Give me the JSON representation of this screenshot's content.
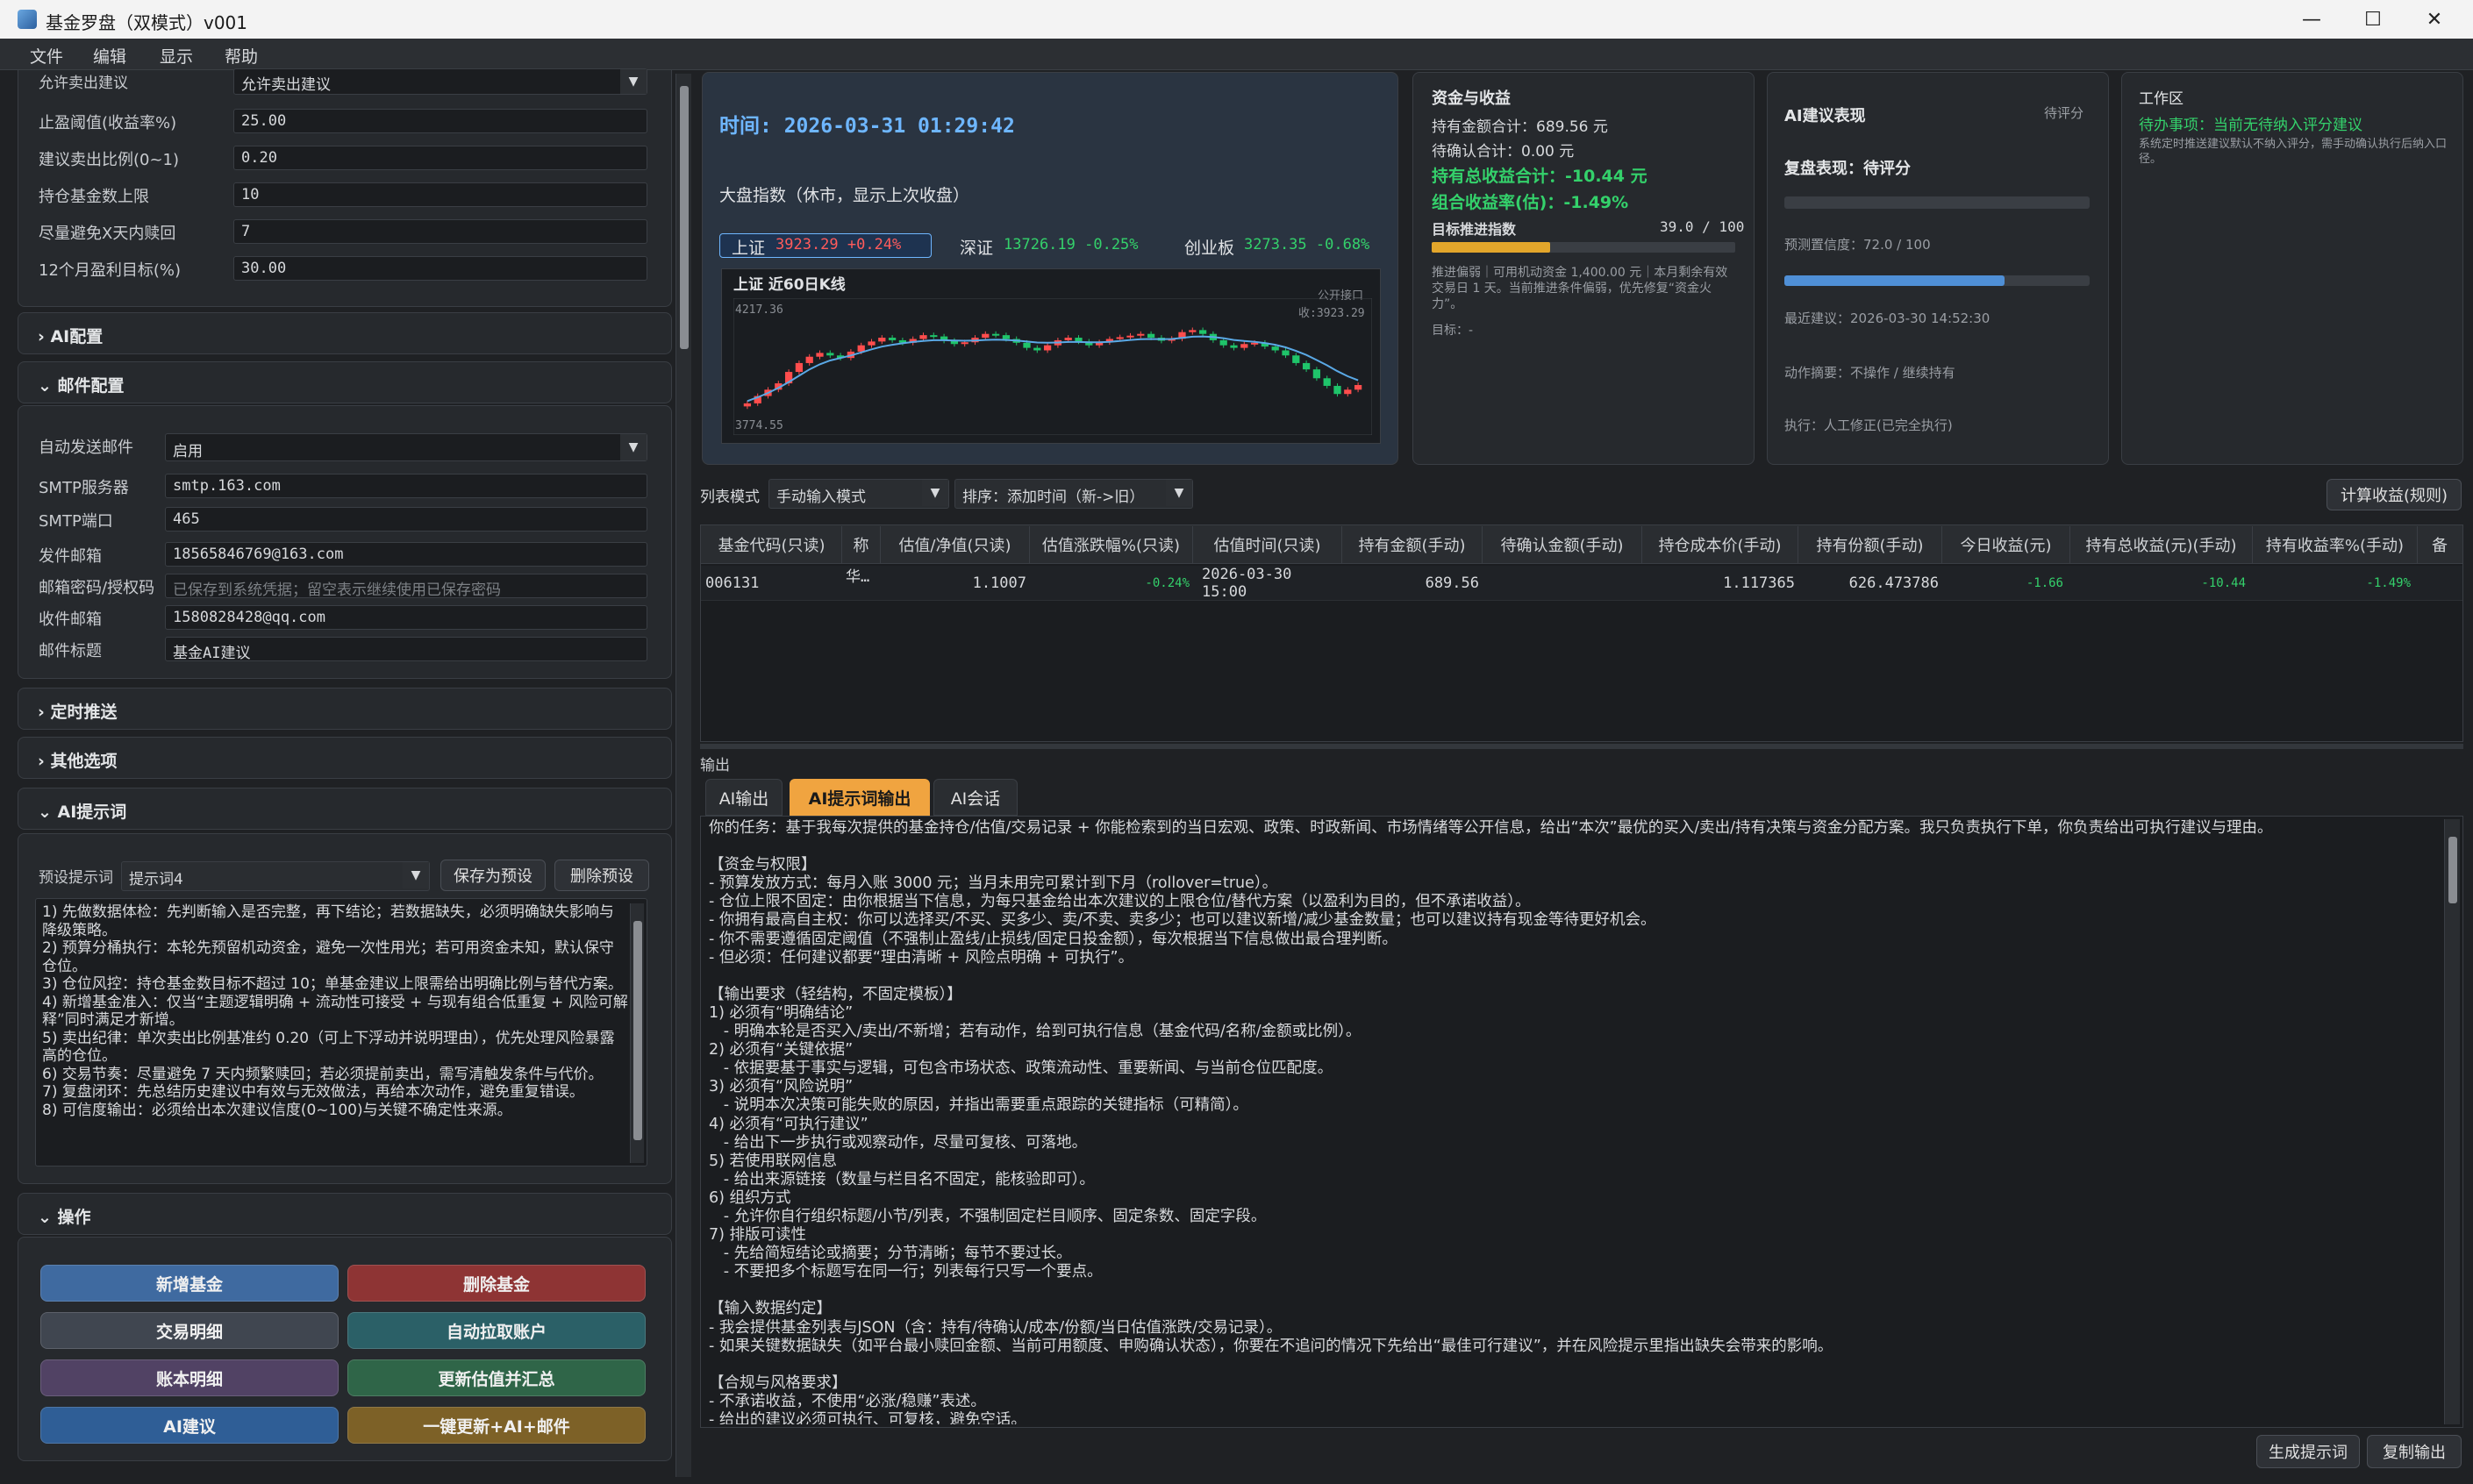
{
  "window": {
    "title": "基金罗盘（双模式）v001",
    "minimize": "—",
    "maximize": "☐",
    "close": "✕"
  },
  "menu": [
    "文件",
    "编辑",
    "显示",
    "帮助"
  ],
  "left": {
    "sell_row": {
      "label": "允许卖出建议",
      "value": "允许卖出建议"
    },
    "params": [
      {
        "label": "止盈阈值(收益率%)",
        "value": "25.00"
      },
      {
        "label": "建议卖出比例(0~1)",
        "value": "0.20"
      },
      {
        "label": "持仓基金数上限",
        "value": "10"
      },
      {
        "label": "尽量避免X天内赎回",
        "value": "7"
      },
      {
        "label": "12个月盈利目标(%)",
        "value": "30.00"
      }
    ],
    "sections": {
      "ai_config": "› AI配置",
      "mail_config": "⌄ 邮件配置",
      "schedule": "› 定时推送",
      "other": "› 其他选项",
      "ai_prompt": "⌄ AI提示词",
      "ops": "⌄ 操作"
    },
    "mail": {
      "auto_send_label": "自动发送邮件",
      "auto_send_value": "启用",
      "smtp_label": "SMTP服务器",
      "smtp_value": "smtp.163.com",
      "port_label": "SMTP端口",
      "port_value": "465",
      "from_label": "发件邮箱",
      "from_value": "18565846769@163.com",
      "pwd_label": "邮箱密码/授权码",
      "pwd_placeholder": "已保存到系统凭据；留空表示继续使用已保存密码",
      "to_label": "收件邮箱",
      "to_value": "1580828428@qq.com",
      "subject_label": "邮件标题",
      "subject_value": "基金AI建议"
    },
    "prompt": {
      "preset_label": "预设提示词",
      "preset_value": "提示词4",
      "save_btn": "保存为预设",
      "delete_btn": "删除预设",
      "lines": [
        "1) 先做数据体检：先判断输入是否完整，再下结论；若数据缺失，必须明确缺失影响与降级策略。",
        "2) 预算分桶执行：本轮先预留机动资金，避免一次性用光；若可用资金未知，默认保守仓位。",
        "3) 仓位风控：持仓基金数目标不超过 10；单基金建议上限需给出明确比例与替代方案。",
        "4) 新增基金准入：仅当“主题逻辑明确 + 流动性可接受 + 与现有组合低重复 + 风险可解释”同时满足才新增。",
        "5) 卖出纪律：单次卖出比例基准约 0.20（可上下浮动并说明理由），优先处理风险暴露高的仓位。",
        "6) 交易节奏：尽量避免 7 天内频繁赎回；若必须提前卖出，需写清触发条件与代价。",
        "7) 复盘闭环：先总结历史建议中有效与无效做法，再给本次动作，避免重复错误。",
        "8) 可信度输出：必须给出本次建议信度(0~100)与关键不确定性来源。"
      ]
    },
    "ops": {
      "add_fund": "新增基金",
      "delete_fund": "删除基金",
      "trade_detail": "交易明细",
      "auto_pull": "自动拉取账户",
      "account_detail": "账本明细",
      "update_valuation": "更新估值并汇总",
      "ai_suggest": "AI建议",
      "one_click": "一键更新+AI+邮件"
    }
  },
  "market": {
    "time": "时间: 2026-03-31 01:29:42",
    "index_title": "大盘指数（休市，显示上次收盘）",
    "sh": {
      "name": "上证",
      "value": "3923.29 +0.24%"
    },
    "sz": {
      "name": "深证",
      "value": "13726.19 -0.25%"
    },
    "cyb": {
      "name": "创业板",
      "value": "3273.35 -0.68%"
    }
  },
  "kchart": {
    "title": "上证 近60日K线",
    "source": "公开接口",
    "high_label": "4217.36",
    "low_label": "3774.55",
    "close_label": "收:3923.29"
  },
  "chart_data": {
    "type": "candlestick",
    "title": "上证 近60日K线",
    "ylim": [
      3774.55,
      4217.36
    ],
    "close": [
      3851,
      3880,
      3905,
      3930,
      3975,
      4010,
      4035,
      4050,
      4040,
      4030,
      4055,
      4080,
      4095,
      4110,
      4100,
      4090,
      4105,
      4120,
      4115,
      4098,
      4085,
      4092,
      4110,
      4125,
      4120,
      4105,
      4090,
      4070,
      4060,
      4080,
      4100,
      4110,
      4095,
      4080,
      4092,
      4105,
      4112,
      4118,
      4125,
      4110,
      4098,
      4106,
      4132,
      4140,
      4125,
      4100,
      4080,
      4070,
      4085,
      4090,
      4075,
      4060,
      4040,
      4010,
      3985,
      3950,
      3920,
      3888,
      3905,
      3923.29
    ],
    "ma": [
      3860,
      3875,
      3892,
      3912,
      3935,
      3960,
      3985,
      4005,
      4020,
      4030,
      4040,
      4052,
      4064,
      4075,
      4082,
      4088,
      4093,
      4097,
      4100,
      4100,
      4099,
      4098,
      4099,
      4101,
      4102,
      4101,
      4099,
      4095,
      4091,
      4090,
      4091,
      4093,
      4093,
      4092,
      4092,
      4094,
      4097,
      4101,
      4104,
      4105,
      4104,
      4105,
      4109,
      4114,
      4115,
      4113,
      4108,
      4101,
      4097,
      4094,
      4089,
      4082,
      4072,
      4058,
      4042,
      4022,
      4001,
      3978,
      3958,
      3942
    ]
  },
  "capital": {
    "title": "资金与收益",
    "hold_total": "持有金额合计：689.56 元",
    "pending_total": "待确认合计：0.00 元",
    "profit_total": "持有总收益合计：-10.44 元",
    "rate": "组合收益率(估)：-1.49%",
    "goal_label": "目标推进指数",
    "goal_value": "39.0 / 100",
    "goal_progress": 0.39,
    "note": "推进偏弱｜可用机动资金 1,400.00 元｜本月剩余有效交易日 1 天。当前推进条件偏弱，优先修复“资金火力”。",
    "target": "目标：-"
  },
  "ai_perf": {
    "title": "AI建议表现",
    "pending": "待评分",
    "review": "复盘表现：待评分",
    "review_progress": 0,
    "confidence": "预测置信度：72.0 / 100",
    "confidence_progress": 0.72,
    "latest": "最近建议：2026-03-30 14:52:30",
    "action": "动作摘要：不操作 / 继续持有",
    "exec": "执行：人工修正(已完全执行)"
  },
  "workspace": {
    "title": "工作区",
    "todo": "待办事项：当前无待纳入评分建议",
    "desc": "系统定时推送建议默认不纳入评分，需手动确认执行后纳入口径。"
  },
  "list": {
    "mode_label": "列表模式",
    "mode_value": "手动输入模式",
    "sort_value": "排序：添加时间（新->旧）",
    "calc_btn": "计算收益(规则)",
    "headers": [
      "基金代码(只读)",
      "称",
      "估值/净值(只读)",
      "估值涨跌幅%(只读)",
      "估值时间(只读)",
      "持有金额(手动)",
      "待确认金额(手动)",
      "持仓成本价(手动)",
      "持有份额(手动)",
      "今日收益(元)",
      "持有总收益(元)(手动)",
      "持有收益率%(手动)",
      "备"
    ],
    "row": {
      "code": "006131",
      "name": "华…",
      "nav": "1.1007",
      "chg": "-0.24%",
      "time": "2026-03-30 15:00",
      "amount": "689.56",
      "pending": "",
      "cost": "1.117365",
      "shares": "626.473786",
      "today": "-1.66",
      "total": "-10.44",
      "rate": "-1.49%"
    }
  },
  "output": {
    "title": "输出",
    "tabs": [
      "AI输出",
      "AI提示词输出",
      "AI会话"
    ],
    "text": "你的任务：基于我每次提供的基金持仓/估值/交易记录 + 你能检索到的当日宏观、政策、时政新闻、市场情绪等公开信息，给出“本次”最优的买入/卖出/持有决策与资金分配方案。我只负责执行下单，你负责给出可执行建议与理由。\n\n【资金与权限】\n- 预算发放方式：每月入账 3000 元；当月未用完可累计到下月（rollover=true）。\n- 仓位上限不固定：由你根据当下信息，为每只基金给出本次建议的上限仓位/替代方案（以盈利为目的，但不承诺收益）。\n- 你拥有最高自主权：你可以选择买/不买、买多少、卖/不卖、卖多少；也可以建议新增/减少基金数量；也可以建议持有现金等待更好机会。\n- 你不需要遵循固定阈值（不强制止盈线/止损线/固定日投金额），每次根据当下信息做出最合理判断。\n- 但必须：任何建议都要“理由清晰 + 风险点明确 + 可执行”。\n\n【输出要求（轻结构，不固定模板）】\n1) 必须有“明确结论”\n   - 明确本轮是否买入/卖出/不新增；若有动作，给到可执行信息（基金代码/名称/金额或比例）。\n2) 必须有“关键依据”\n   - 依据要基于事实与逻辑，可包含市场状态、政策流动性、重要新闻、与当前仓位匹配度。\n3) 必须有“风险说明”\n   - 说明本次决策可能失败的原因，并指出需要重点跟踪的关键指标（可精简）。\n4) 必须有“可执行建议”\n   - 给出下一步执行或观察动作，尽量可复核、可落地。\n5) 若使用联网信息\n   - 给出来源链接（数量与栏目名不固定，能核验即可）。\n6) 组织方式\n   - 允许你自行组织标题/小节/列表，不强制固定栏目顺序、固定条数、固定字段。\n7) 排版可读性\n   - 先给简短结论或摘要；分节清晰；每节不要过长。\n   - 不要把多个标题写在同一行；列表每行只写一个要点。\n\n【输入数据约定】\n- 我会提供基金列表与JSON（含：持有/待确认/成本/份额/当日估值涨跌/交易记录）。\n- 如果关键数据缺失（如平台最小赎回金额、当前可用额度、申购确认状态），你要在不追问的情况下先给出“最佳可行建议”，并在风险提示里指出缺失会带来的影响。\n\n【合规与风格要求】\n- 不承诺收益，不使用“必涨/稳赚”表述。\n- 给出的建议必须可执行、可复核，避免空话。",
    "gen_btn": "生成提示词",
    "copy_btn": "复制输出"
  }
}
